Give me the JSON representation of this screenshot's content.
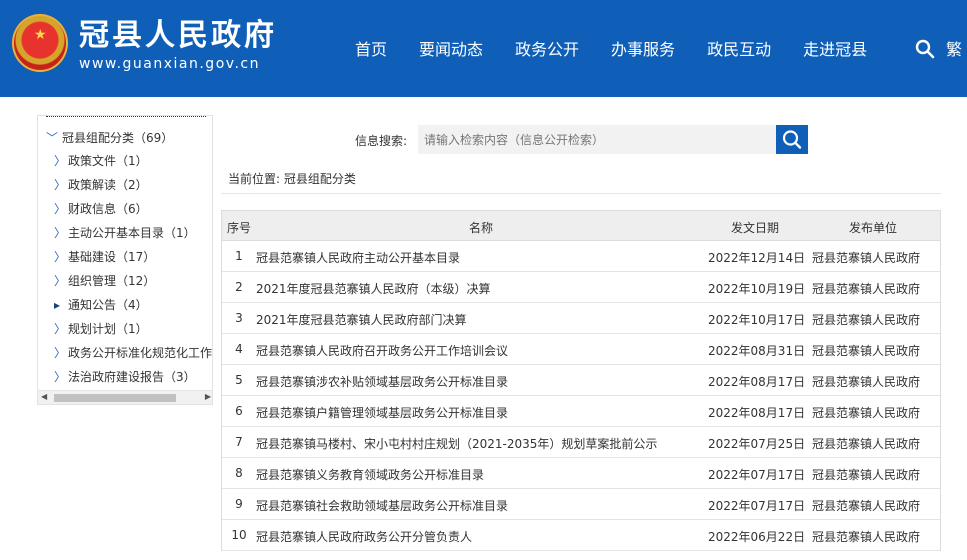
{
  "header": {
    "title": "冠县人民政府",
    "url": "www.guanxian.gov.cn",
    "nav": [
      "首页",
      "要闻动态",
      "政务公开",
      "办事服务",
      "政民互动",
      "走进冠县"
    ],
    "more": "繁"
  },
  "sidebar": {
    "root": "冠县组配分类（69）",
    "items": [
      {
        "label": "政策文件（1）"
      },
      {
        "label": "政策解读（2）"
      },
      {
        "label": "财政信息（6）"
      },
      {
        "label": "主动公开基本目录（1）"
      },
      {
        "label": "基础建设（17）"
      },
      {
        "label": "组织管理（12）"
      },
      {
        "label": "通知公告（4）"
      },
      {
        "label": "规划计划（1）"
      },
      {
        "label": "政务公开标准化规范化工作"
      },
      {
        "label": "法治政府建设报告（3）"
      }
    ]
  },
  "search": {
    "label": "信息搜索:",
    "placeholder": "请输入检索内容（信息公开检索）"
  },
  "breadcrumb": "当前位置:  冠县组配分类",
  "table": {
    "headers": {
      "no": "序号",
      "name": "名称",
      "date": "发文日期",
      "dept": "发布单位"
    },
    "rows": [
      {
        "no": "1",
        "name": "冠县范寨镇人民政府主动公开基本目录",
        "date": "2022年12月14日",
        "dept": "冠县范寨镇人民政府"
      },
      {
        "no": "2",
        "name": "2021年度冠县范寨镇人民政府（本级）决算",
        "date": "2022年10月19日",
        "dept": "冠县范寨镇人民政府"
      },
      {
        "no": "3",
        "name": "2021年度冠县范寨镇人民政府部门决算",
        "date": "2022年10月17日",
        "dept": "冠县范寨镇人民政府"
      },
      {
        "no": "4",
        "name": "冠县范寨镇人民政府召开政务公开工作培训会议",
        "date": "2022年08月31日",
        "dept": "冠县范寨镇人民政府"
      },
      {
        "no": "5",
        "name": "冠县范寨镇涉农补贴领域基层政务公开标准目录",
        "date": "2022年08月17日",
        "dept": "冠县范寨镇人民政府"
      },
      {
        "no": "6",
        "name": "冠县范寨镇户籍管理领域基层政务公开标准目录",
        "date": "2022年08月17日",
        "dept": "冠县范寨镇人民政府"
      },
      {
        "no": "7",
        "name": "冠县范寨镇马楼村、宋小屯村村庄规划（2021-2035年）规划草案批前公示",
        "date": "2022年07月25日",
        "dept": "冠县范寨镇人民政府"
      },
      {
        "no": "8",
        "name": "冠县范寨镇义务教育领域政务公开标准目录",
        "date": "2022年07月17日",
        "dept": "冠县范寨镇人民政府"
      },
      {
        "no": "9",
        "name": "冠县范寨镇社会救助领域基层政务公开标准目录",
        "date": "2022年07月17日",
        "dept": "冠县范寨镇人民政府"
      },
      {
        "no": "10",
        "name": "冠县范寨镇人民政府政务公开分管负责人",
        "date": "2022年06月22日",
        "dept": "冠县范寨镇人民政府"
      }
    ]
  }
}
